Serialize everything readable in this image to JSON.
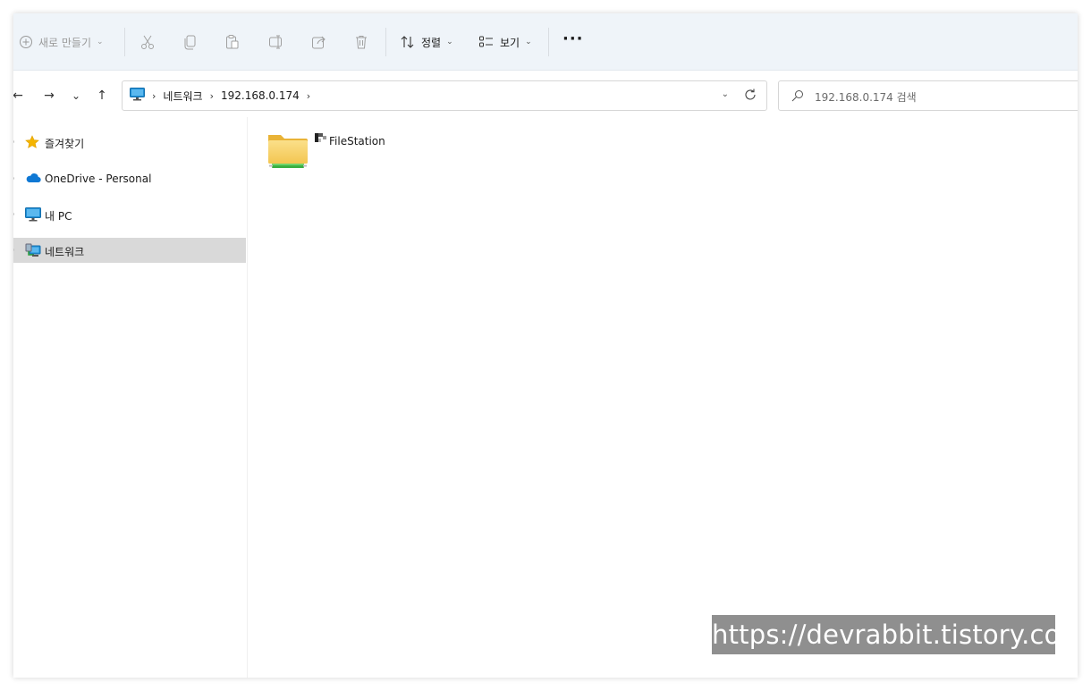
{
  "toolbar": {
    "new_label": "새로 만들기",
    "sort_label": "정렬",
    "view_label": "보기",
    "more_label": "···"
  },
  "icons": {
    "new": "plus-circle-icon",
    "cut": "scissors-icon",
    "copy": "copy-icon",
    "paste": "paste-icon",
    "rename": "rename-icon",
    "share": "share-icon",
    "delete": "trash-icon",
    "sort": "sort-arrows-icon",
    "view": "view-list-icon"
  },
  "nav": {
    "back": "←",
    "forward": "→",
    "recent": "⌄",
    "up": "↑"
  },
  "address": {
    "crumbs": [
      "네트워크",
      "192.168.0.174"
    ]
  },
  "search": {
    "placeholder": "192.168.0.174 검색"
  },
  "sidebar": {
    "items": [
      {
        "label": "즐겨찾기",
        "icon": "star-icon"
      },
      {
        "label": "OneDrive - Personal",
        "icon": "cloud-icon"
      },
      {
        "label": "내 PC",
        "icon": "monitor-icon"
      },
      {
        "label": "네트워크",
        "icon": "network-icon",
        "selected": true
      }
    ]
  },
  "content": {
    "items": [
      {
        "name": "FileStation",
        "icon": "network-share-folder-icon"
      }
    ]
  },
  "watermark": "https://devrabbit.tistory.com",
  "colors": {
    "cmdbar_bg": "#eff4f9",
    "selected_bg": "#d9d9d9",
    "folder_yellow": "#f5c84c",
    "share_green": "#3cb043",
    "onedrive_blue": "#0f78d4",
    "monitor_blue": "#1f8fd6"
  }
}
